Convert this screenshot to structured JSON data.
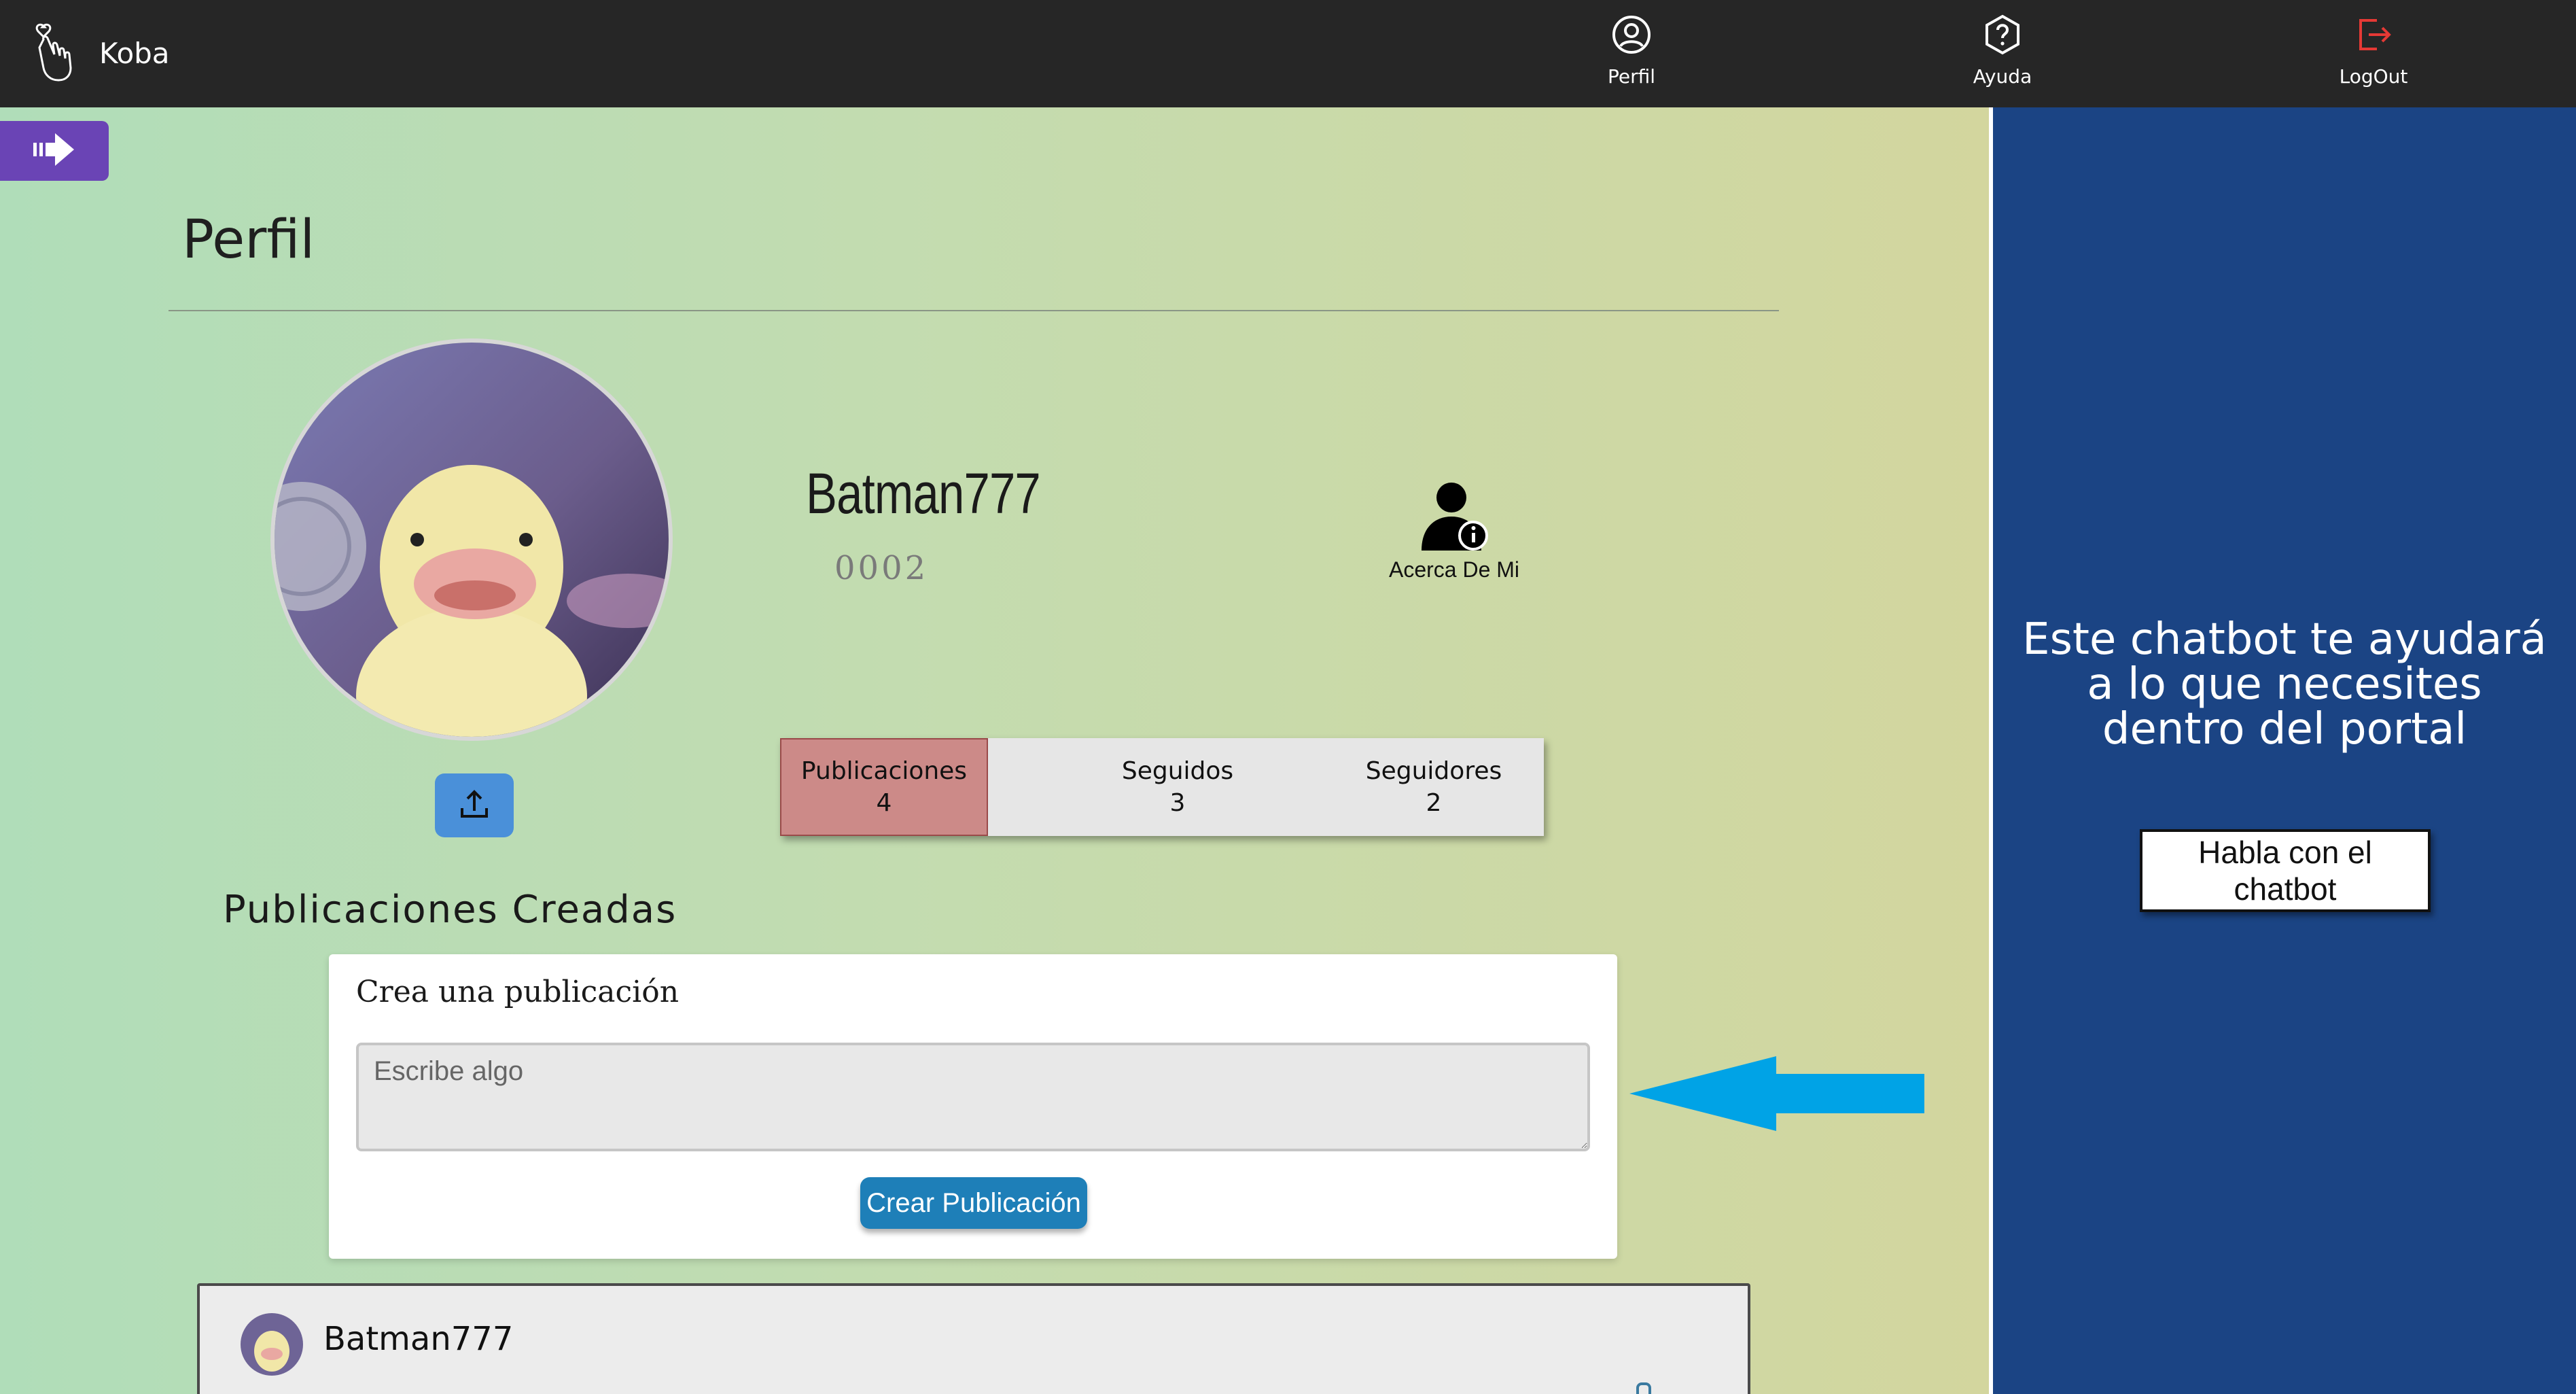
{
  "header": {
    "brand_name": "Koba",
    "nav": [
      {
        "label": "Perfil",
        "icon": "user-circle-icon"
      },
      {
        "label": "Ayuda",
        "icon": "help-hexagon-icon"
      },
      {
        "label": "LogOut",
        "icon": "logout-icon",
        "color": "#e53935"
      }
    ]
  },
  "profile": {
    "page_title": "Perfil",
    "username": "Batman777",
    "user_id": "0002",
    "about_label": "Acerca De Mi",
    "stats": [
      {
        "label": "Publicaciones",
        "value": "4",
        "active": true
      },
      {
        "label": "Seguidos",
        "value": "3",
        "active": false
      },
      {
        "label": "Seguidores",
        "value": "2",
        "active": false
      }
    ]
  },
  "posts": {
    "section_title": "Publicaciones Creadas",
    "create_title": "Crea una publicación",
    "input_placeholder": "Escribe algo",
    "create_button": "Crear Publicación",
    "first_post_user": "Batman777"
  },
  "chatbot": {
    "text_line1": "Este chatbot te ayudará",
    "text_line2": "a lo que necesites",
    "text_line3": "dentro del portal",
    "button_label": "Habla con el chatbot"
  },
  "colors": {
    "topbar": "#262626",
    "accent_purple": "#6a44b5",
    "chat_panel": "#1b4484",
    "create_button": "#1e7fb8",
    "active_stat": "#cc8a88",
    "annotation_arrow": "#00a3e6"
  }
}
